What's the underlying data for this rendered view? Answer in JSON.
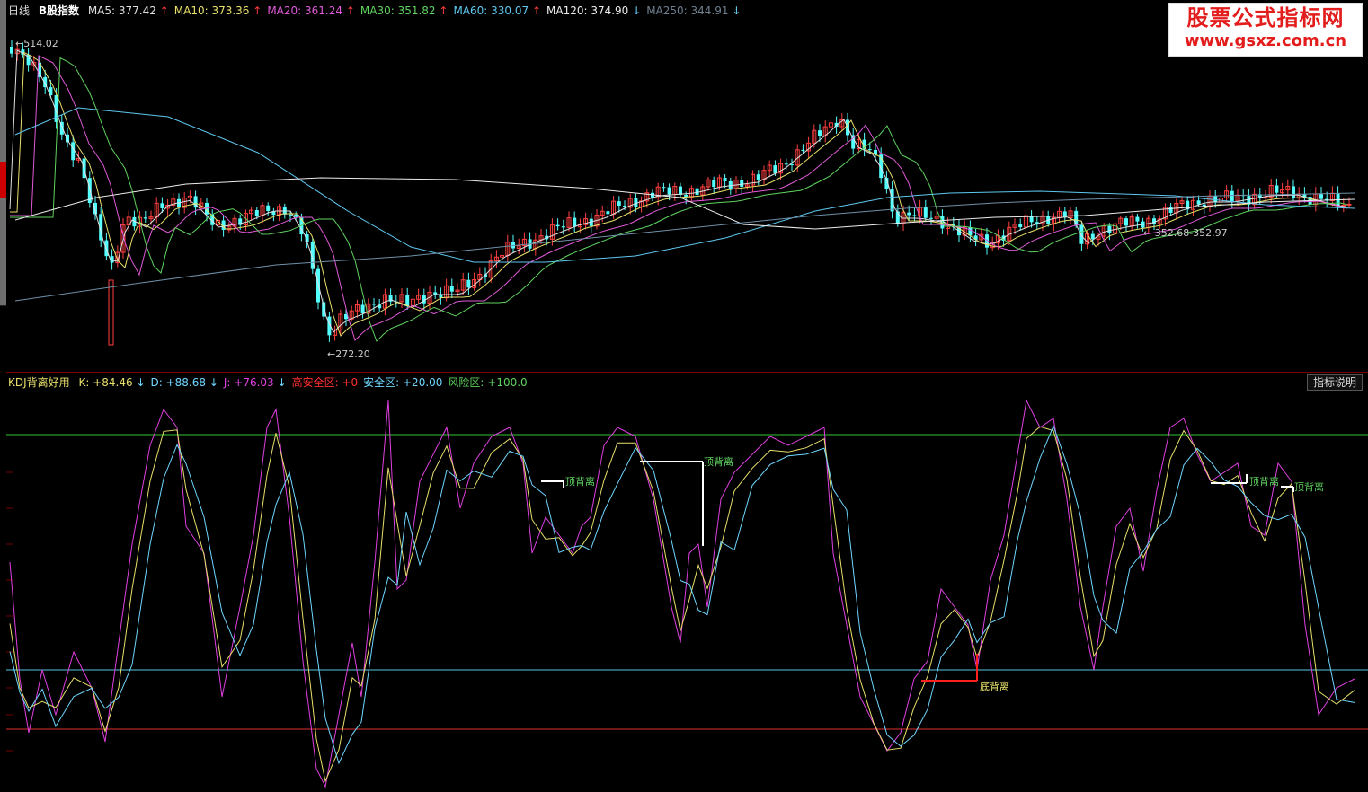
{
  "window": {
    "period_label": "日线",
    "instrument": "B股指数"
  },
  "main": {
    "ma": [
      {
        "label": "MA5:",
        "value": "377.42",
        "dir": "↑",
        "color": "#e0e0e0"
      },
      {
        "label": "MA10:",
        "value": "373.36",
        "dir": "↑",
        "color": "#e8e06a"
      },
      {
        "label": "MA20:",
        "value": "361.24",
        "dir": "↑",
        "color": "#e05ad8"
      },
      {
        "label": "MA30:",
        "value": "351.82",
        "dir": "↑",
        "color": "#5fd35f"
      },
      {
        "label": "MA60:",
        "value": "330.07",
        "dir": "↑",
        "color": "#5ec8f0"
      },
      {
        "label": "MA120:",
        "value": "374.90",
        "dir": "↓",
        "color": "#ececec"
      },
      {
        "label": "MA250:",
        "value": "344.91",
        "dir": "↓",
        "color": "#708090"
      }
    ],
    "annotations": {
      "high": "514.02",
      "low": "272.20",
      "range": "352.68-352.97"
    }
  },
  "indicator": {
    "name": "KDJ背离好用",
    "fields": [
      {
        "label": "K:",
        "value": "+84.46",
        "dir": "↓",
        "color": "#e8e06a"
      },
      {
        "label": "D:",
        "value": "+88.68",
        "dir": "↓",
        "color": "#6fd7ff"
      },
      {
        "label": "J:",
        "value": "+76.03",
        "dir": "↓",
        "color": "#e040e0"
      },
      {
        "label": "高安全区:",
        "value": "+0",
        "dir": "",
        "color": "#ff3030"
      },
      {
        "label": "安全区:",
        "value": "+20.00",
        "dir": "",
        "color": "#6fd7ff"
      },
      {
        "label": "风险区:",
        "value": "+100.0",
        "dir": "",
        "color": "#5fd35f"
      }
    ],
    "explain_button": "指标说明",
    "labels": {
      "top_div": "顶背离",
      "bottom_div": "底背离"
    }
  },
  "watermark": {
    "title": "股票公式指标网",
    "url": "www.gsxz.com.cn"
  },
  "colors": {
    "up": "#ff4040",
    "down": "#54ffff",
    "k": "#e8e06a",
    "d": "#6fd7ff",
    "j": "#e040e0"
  },
  "chart_data": {
    "type": "candlestick",
    "price_range": [
      272.2,
      514.02
    ],
    "kdj_levels": {
      "risk": 100,
      "safe": 20,
      "high_safe": 0
    }
  }
}
